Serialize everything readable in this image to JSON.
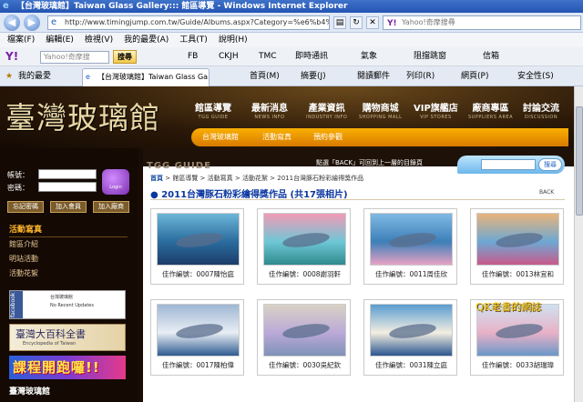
{
  "window": {
    "title": "【台灣玻璃館】Taiwan Glass Gallery::: 館區導覽 - Windows Internet Explorer"
  },
  "address_bar": {
    "url": "http://www.timingjump.com.tw/Guide/Albums.aspx?Category=%e6%b4%b",
    "search_placeholder": "Yahoo!奇摩搜尋"
  },
  "menu": [
    "檔案(F)",
    "編輯(E)",
    "檢視(V)",
    "我的最愛(A)",
    "工具(T)",
    "說明(H)"
  ],
  "toolbar": {
    "yahoo_logo": "Y!",
    "search_placeholder": "Yahoo!奇摩搜",
    "search_button": "搜尋",
    "items": [
      "FB",
      "CKJH",
      "TMC",
      "即時通訊",
      "氣象",
      "阻擋跳窗",
      "信箱"
    ]
  },
  "tabbar": {
    "favorites": "我的最愛",
    "tab_title": "【台灣玻璃館】Taiwan Glass Ga...",
    "commands": [
      "首頁(M)",
      "摘要(J)",
      "閱讀郵件",
      "列印(R)",
      "網頁(P)",
      "安全性(S)"
    ]
  },
  "site": {
    "logo": "臺灣玻璃館",
    "global_nav": [
      {
        "zh": "館區導覽",
        "en": "TGG GUIDE"
      },
      {
        "zh": "最新消息",
        "en": "NEWS INFO"
      },
      {
        "zh": "產業資訊",
        "en": "INDUSTRY INFO"
      },
      {
        "zh": "購物商城",
        "en": "SHOPPING MALL"
      },
      {
        "zh": "VIP旗艦店",
        "en": "VIP STORES"
      },
      {
        "zh": "廠商專區",
        "en": "SUPPLIERS AREA"
      },
      {
        "zh": "討論交流",
        "en": "DISCUSSION"
      }
    ],
    "sub_nav": [
      "台灣玻璃館",
      "活動寫真",
      "預約參觀"
    ],
    "section_label": "TGG GUIDE",
    "notice": "點選「BACK」可回到上一層的目錄頁",
    "search_button": "搜尋"
  },
  "sidebar": {
    "account_label": "帳號：",
    "password_label": "密碼：",
    "login_label": "Login",
    "buttons": [
      "忘記密碼",
      "加入會員",
      "加入廠商"
    ],
    "section_title": "活動寫真",
    "links": [
      "館區介紹",
      "明站活動",
      "活動花絮"
    ],
    "fb_side": "facebook",
    "fb_name": "台灣玻璃館",
    "fb_note": "No Recent Updates",
    "ency_title": "臺灣大百科全書",
    "ency_en": "Encyclopedia of Taiwan",
    "course_banner": "課程開跑囉!!",
    "bottom_logo": "臺灣玻璃館"
  },
  "content": {
    "breadcrumb": {
      "home": "首頁",
      "path": "> 館區導覽 > 活動寫真 > 活動花絮 > 2011台灣豚石粉彩繪得獎作品"
    },
    "title": "2011台灣豚石粉彩繪得獎作品 (共17張相片)",
    "back": "BACK",
    "cards": [
      {
        "caption": "佳作編號：0007陳怡庭"
      },
      {
        "caption": "佳作編號：0008謝羽軒"
      },
      {
        "caption": "佳作編號：0011周佳欣"
      },
      {
        "caption": "佳作編號：0013林宜和"
      },
      {
        "caption": "佳作編號：0017陳柏偉"
      },
      {
        "caption": "佳作編號：0030吳紀欽"
      },
      {
        "caption": "佳作編號：0031陳立庭"
      },
      {
        "caption": "佳作編號：0033胡瑞瑋"
      }
    ]
  },
  "watermark": "QK老書的網誌",
  "colors": {
    "ie_title": "#2354b3",
    "site_dark": "#1a0d05",
    "subnav_orange": "#f9b000",
    "title_blue": "#0a36a0"
  }
}
